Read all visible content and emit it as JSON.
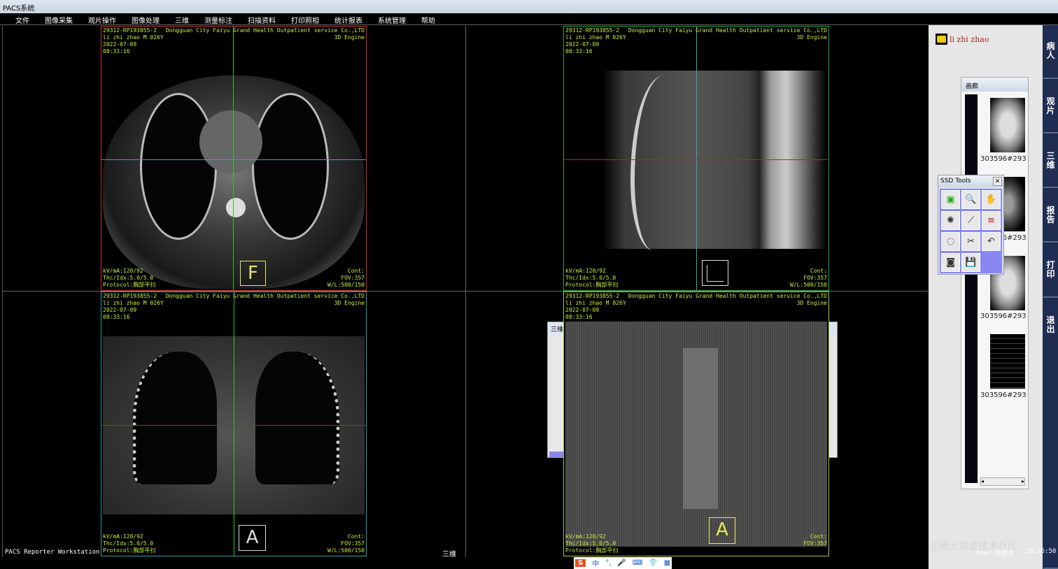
{
  "window": {
    "title": "PACS系统"
  },
  "menu": [
    "文件",
    "图像采集",
    "观片操作",
    "图像处理",
    "三维",
    "测量标注",
    "扫描资料",
    "打印照相",
    "统计报表",
    "系统管理",
    "帮助"
  ],
  "viewports": [
    {
      "id": "axial",
      "top_left": "29312-RP193855-2\nli zhi zhao M 026Y\n2022-07-09\n08:33:16",
      "top_right": "Dongguan City Faiyu Grand Health Outpatient service Co.,LTD\n3D Engine",
      "bottom_left": "kV/mA:120/92\nThc/Idx:5.0/5.0\nProtocol:胸部平扫",
      "bottom_right": "Cont:\nFOV:357\nW/L:500/150",
      "orientation": "F",
      "border": "#c83030"
    },
    {
      "id": "sagittal",
      "top_left": "29312-RP193855-2\nli zhi zhao M 026Y\n2022-07-09\n08:33:16",
      "top_right": "Dongguan City Faiyu Grand Health Outpatient service Co.,LTD\n3D Engine",
      "bottom_left": "kV/mA:120/92\nThc/Idx:5.0/5.0\nProtocol:胸部平扫",
      "bottom_right": "Cont:\nFOV:357\nW/L:500/150",
      "orientation": "",
      "border": "#30a040"
    },
    {
      "id": "coronal",
      "top_left": "29312-RP193855-2\nli zhi zhao M 026Y\n2022-07-09\n08:33:16",
      "top_right": "Dongguan City Faiyu Grand Health Outpatient service Co.,LTD\n3D Engine",
      "bottom_left": "kV/mA:120/92\nThc/Idx:5.0/5.0\nProtocol:胸部平扫",
      "bottom_right": "Cont:\nFOV:357\nW/L:500/150",
      "orientation": "A",
      "border": "#30a0a0"
    },
    {
      "id": "volume",
      "top_left": "29312-RP193855-2\nli zhi zhao M 026Y\n2022-07-09\n08:33:16",
      "top_right": "Dongguan City Faiyu Grand Health Outpatient service Co.,LTD\n3D Engine",
      "bottom_left": "kV/mA:120/92\nThc/Idx:5.0/5.0\nProtocol:胸部平扫",
      "bottom_right": "Cont:\nFOV:357",
      "orientation": "A",
      "border": "#b0c040"
    }
  ],
  "dialog_3d": {
    "title": "三维"
  },
  "patient": {
    "name": "li zhi zhao",
    "icon": "folder-icon"
  },
  "gallery": {
    "title": "画廊",
    "thumbnails": [
      "303596#293",
      "303596#293",
      "303596#293",
      "303596#293"
    ]
  },
  "ssd_tools": {
    "title": "SSD Tools",
    "close": "✕",
    "tools": [
      "cube-a-icon",
      "zoom-icon",
      "pan-hand-icon",
      "rotate-icon",
      "ruler-icon",
      "color-bars-icon",
      "lasso-icon",
      "scissors-icon",
      "undo-icon",
      "snapshot-icon",
      "save-icon"
    ]
  },
  "side_tabs": [
    "病人",
    "观片",
    "三维",
    "报告",
    "打印",
    "退出"
  ],
  "status": {
    "app": "PACS Reporter Workstation",
    "mode": "三维",
    "user": "User:管理员",
    "time": "16:16:50",
    "watermark": "@稀土掘金技术社区"
  },
  "ime": {
    "items": [
      "中",
      "°,",
      "🎤",
      "⌨",
      "👕",
      "▦"
    ]
  }
}
